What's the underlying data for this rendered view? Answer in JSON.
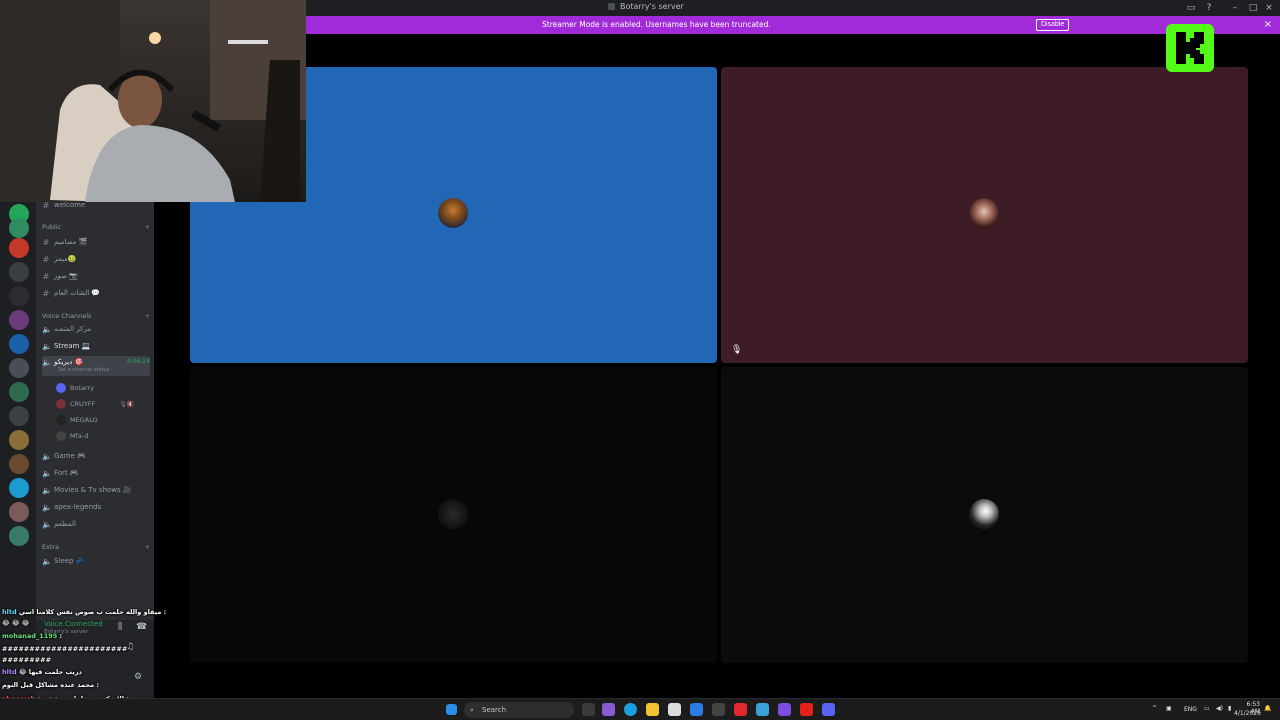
{
  "window": {
    "title": "Botarry's server"
  },
  "banner": {
    "text": "Streamer Mode is enabled. Usernames have been truncated.",
    "disable_label": "Disable",
    "color": "#a12bd9"
  },
  "channels": {
    "top_item": "welcome",
    "category_public": "Public",
    "public_items": [
      "مصاميم 🎬",
      "ميمز🤢",
      "صور 📷",
      "الشات العام 💬"
    ],
    "category_voice": "Voice Channels",
    "voice_items_before": [
      "مركز المتصه"
    ],
    "stream_label": "Stream 💻",
    "active_channel": {
      "label": "ديريكو 🎯",
      "timer": "4:06:24",
      "status": "Set a channel status"
    },
    "users": [
      "Botarry",
      "CRUYFF",
      "MEGALO",
      "Mfa-d"
    ],
    "voice_items_after": [
      "Game 🎮",
      "Fort 🎮",
      "Movies & Tv shows 🎥",
      "apex-legends",
      "المطعم"
    ],
    "category_extra": "Extra",
    "extra_items": [
      "Sleep 💤"
    ]
  },
  "user_panel": {
    "voice_connected": "Voice Connected",
    "server": "Botarry's server"
  },
  "chat": {
    "messages": [
      {
        "name": "hltd",
        "text": "ميقاو والله حلمت ب صوص نفس كلامنا اسي :",
        "color": "blue"
      },
      {
        "name": "",
        "text": "😂 😂 😂",
        "color": "blue"
      },
      {
        "name": "mohanad_1195",
        "text": ":",
        "color": "green"
      },
      {
        "name": "",
        "text": "#######################",
        "color": "blue"
      },
      {
        "name": "",
        "text": "#########",
        "color": "blue"
      },
      {
        "name": "hltd",
        "text": "😂 دريب حلمت فيها",
        "color": "purple"
      },
      {
        "name": "",
        "text": "محمد عنده مشاكل قبل النوم :",
        "color": "blue"
      },
      {
        "name": "aboomsh",
        "text": "الايفكت يبي لها مزنبة قوية :",
        "color": "red"
      }
    ]
  },
  "call": {
    "tiles": [
      {
        "id": "tile1",
        "bg": "#2167b6"
      },
      {
        "id": "tile2",
        "bg": "#3d1c25"
      },
      {
        "id": "tile3",
        "bg": "#070707"
      },
      {
        "id": "tile4",
        "bg": "#0a0b0c"
      }
    ]
  },
  "taskbar": {
    "search_placeholder": "Search",
    "lang": "ENG",
    "time": "6:53 AM",
    "date": "4/1/2026"
  },
  "colors": {
    "discord_bg": "#2b2d31",
    "rail_bg": "#1e1f22",
    "kick_green": "#53fc18"
  }
}
